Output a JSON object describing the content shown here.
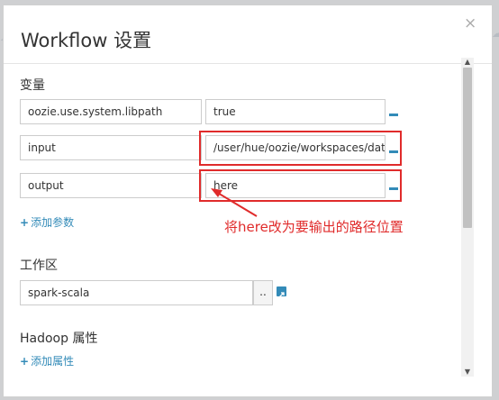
{
  "modal": {
    "title": "Workflow 设置",
    "close_label": "×"
  },
  "variables": {
    "section_label": "变量",
    "rows": [
      {
        "name": "oozie.use.system.libpath",
        "value": "true"
      },
      {
        "name": "input",
        "value": "/user/hue/oozie/workspaces/data/"
      },
      {
        "name": "output",
        "value": "here"
      }
    ],
    "add_label": "添加参数"
  },
  "workspace": {
    "section_label": "工作区",
    "value": "spark-scala",
    "browse_label": ".."
  },
  "hadoop": {
    "section_label": "Hadoop 属性",
    "add_label": "添加属性"
  },
  "annotation": {
    "text": "将here改为要输出的路径位置",
    "color": "#e02b2b"
  },
  "colors": {
    "accent": "#338bb8",
    "highlight": "#e02b2b"
  }
}
